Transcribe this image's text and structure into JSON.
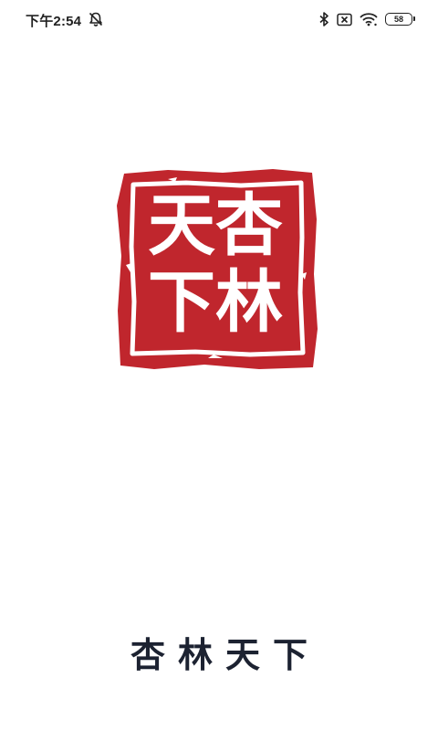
{
  "status_bar": {
    "time": "下午2:54",
    "left_icon": "alarm-off-icon",
    "right_icons": [
      "bluetooth-icon",
      "sim-off-icon",
      "wifi-icon"
    ],
    "battery_level": "58"
  },
  "splash": {
    "seal_text": [
      "杏",
      "林",
      "天",
      "下"
    ],
    "seal_color": "#c0262d",
    "app_name": "杏林天下",
    "title_color": "#1c2231"
  }
}
